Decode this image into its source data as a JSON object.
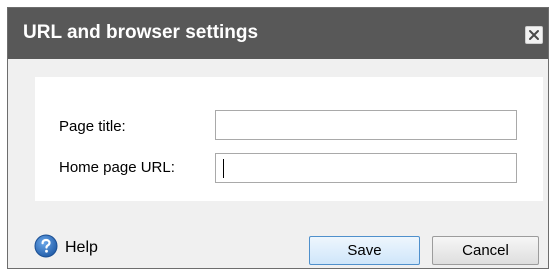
{
  "dialog": {
    "title": "URL and browser settings",
    "close_icon": "close-icon"
  },
  "form": {
    "page_title_label": "Page title:",
    "page_title_value": "",
    "home_url_label": "Home page URL:",
    "home_url_value": ""
  },
  "footer": {
    "help_label": "Help",
    "help_icon": "question-mark-circle-icon",
    "save_label": "Save",
    "cancel_label": "Cancel"
  },
  "colors": {
    "titlebar": "#585858",
    "dialog_bg": "#f0f0f0",
    "save_border": "#4f90cc",
    "help_icon": "#2f6db5"
  }
}
